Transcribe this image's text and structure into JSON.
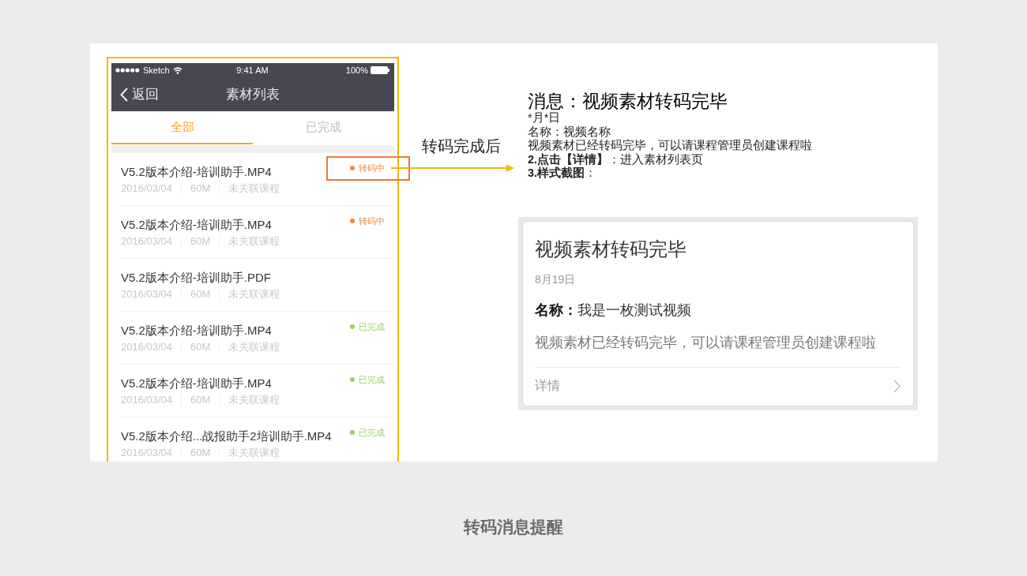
{
  "phone": {
    "status_bar": {
      "carrier": "Sketch",
      "time": "9:41 AM",
      "battery": "100%"
    },
    "nav_bar": {
      "back": "返回",
      "title": "素材列表"
    },
    "tabs": [
      {
        "label": "全部",
        "selected": true
      },
      {
        "label": "已完成",
        "selected": false
      }
    ],
    "items": [
      {
        "title": "V5.2版本介绍-培训助手.MP4",
        "date": "2016/03/04",
        "size": "60M",
        "course": "未关联课程",
        "status": {
          "label": "转码中",
          "color": "#f0883a"
        },
        "highlighted": true
      },
      {
        "title": "V5.2版本介绍-培训助手.MP4",
        "date": "2016/03/04",
        "size": "60M",
        "course": "未关联课程",
        "status": {
          "label": "转码中",
          "color": "#f0883a"
        },
        "highlighted": false
      },
      {
        "title": "V5.2版本介绍-培训助手.PDF",
        "date": "2016/03/04",
        "size": "60M",
        "course": "未关联课程",
        "highlighted": false
      },
      {
        "title": "V5.2版本介绍-培训助手.MP4",
        "date": "2016/03/04",
        "size": "60M",
        "course": "未关联课程",
        "status": {
          "label": "已完成",
          "color": "#9ccf5a"
        },
        "highlighted": false
      },
      {
        "title": "V5.2版本介绍-培训助手.MP4",
        "date": "2016/03/04",
        "size": "60M",
        "course": "未关联课程",
        "status": {
          "label": "已完成",
          "color": "#9ccf5a"
        },
        "highlighted": false
      },
      {
        "title": "V5.2版本介绍...战报助手2培训助手.MP4",
        "date": "2016/03/04",
        "size": "60M",
        "course": "未关联课程",
        "status": {
          "label": "已完成",
          "color": "#9ccf5a"
        },
        "highlighted": false
      }
    ]
  },
  "annotation": {
    "label": "转码完成后"
  },
  "spec": {
    "title": "消息：视频素材转码完毕",
    "lines": [
      "*月*日",
      "名称：视频名称",
      "视频素材已经转码完毕，可以请课程管理员创建课程啦",
      "**2.点击【详情】**：进入素材列表页",
      "**3.样式截图**："
    ]
  },
  "preview_card": {
    "title": "视频素材转码完毕",
    "date": "8月19日",
    "name_line": "**名称：**我是一枚测试视频",
    "description": "视频素材已经转码完毕，可以请课程管理员创建课程啦",
    "link": "详情"
  },
  "caption": "转码消息提醒"
}
